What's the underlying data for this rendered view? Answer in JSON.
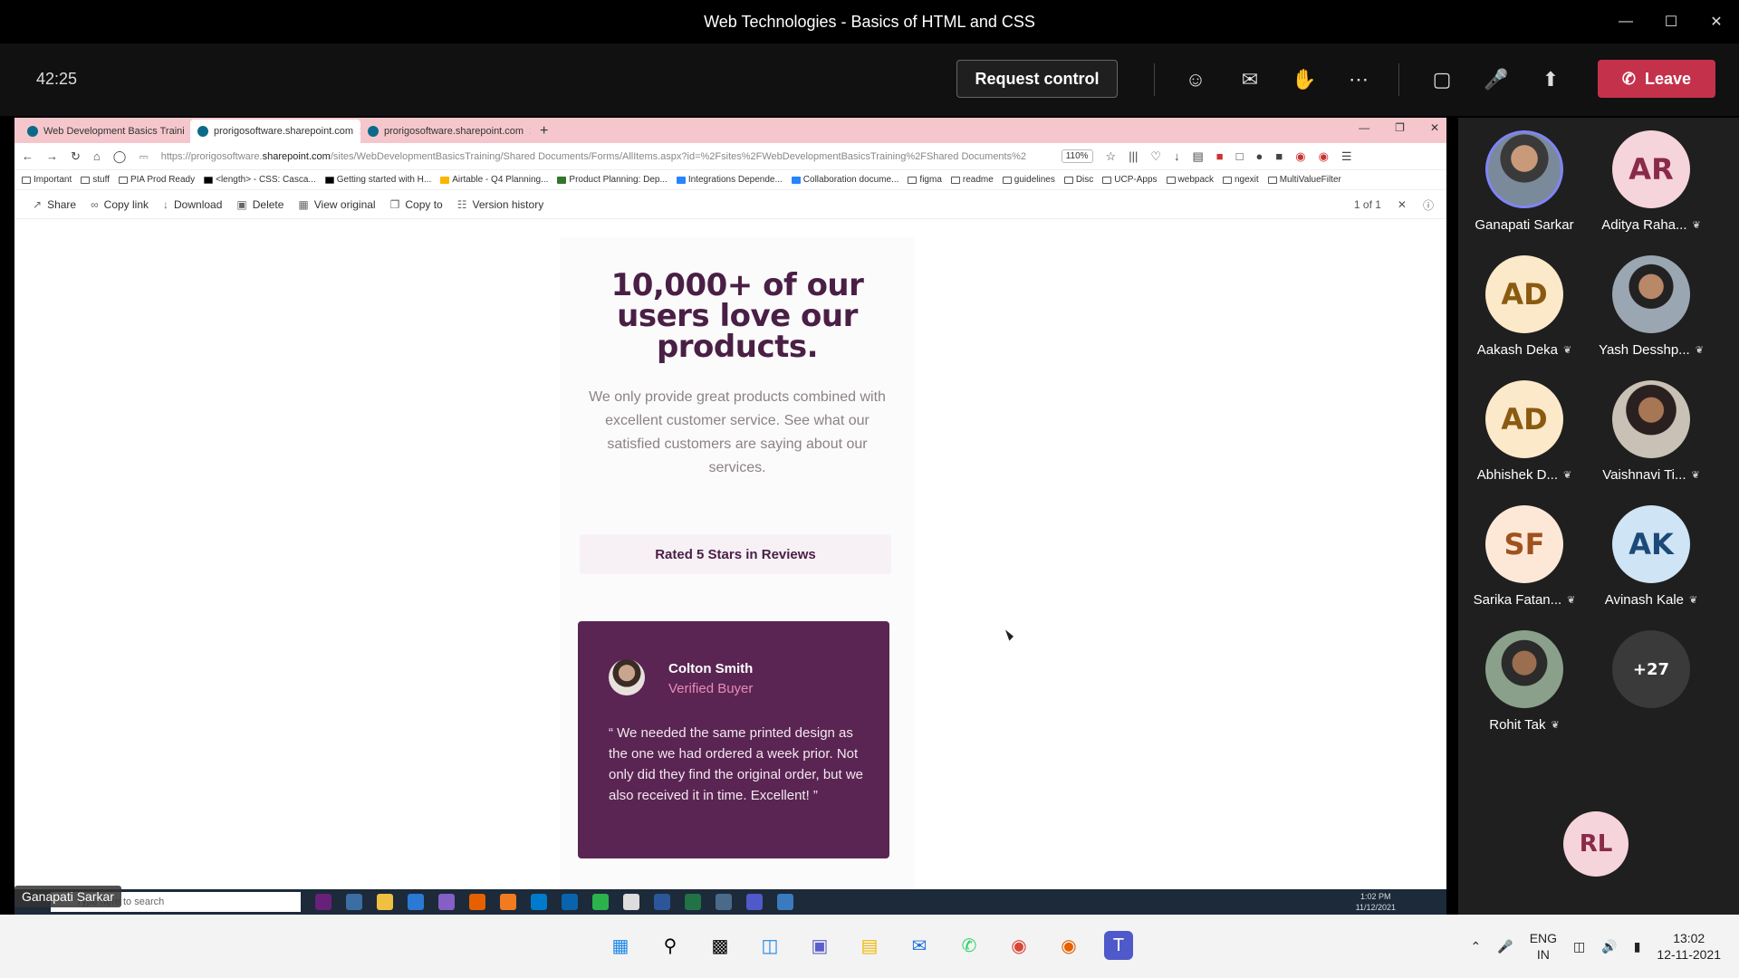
{
  "teams": {
    "window_title": "Web Technologies - Basics of HTML and CSS",
    "timer": "42:25",
    "request_control": "Request control",
    "leave": "Leave",
    "presenter": "Ganapati Sarkar"
  },
  "browser": {
    "tabs": [
      {
        "label": "Web Development Basics Traini"
      },
      {
        "label": "prorigosoftware.sharepoint.com"
      },
      {
        "label": "prorigosoftware.sharepoint.com"
      }
    ],
    "url_prefix": "https://prorigosoftware.",
    "url_domain": "sharepoint.com",
    "url_rest": "/sites/WebDevelopmentBasicsTraining/Shared Documents/Forms/AllItems.aspx?id=%2Fsites%2FWebDevelopmentBasicsTraining%2FShared Documents%2",
    "zoom": "110%",
    "bookmarks": [
      "Important",
      "stuff",
      "PIA Prod Ready",
      "<length> - CSS: Casca...",
      "Getting started with H...",
      "Airtable - Q4 Planning...",
      "Product Planning: Dep...",
      "Integrations Depende...",
      "Collaboration docume...",
      "figma",
      "readme",
      "guidelines",
      "Disc",
      "UCP-Apps",
      "webpack",
      "ngexit",
      "MultiValueFilter"
    ]
  },
  "sharepoint": {
    "share": "Share",
    "copy_link": "Copy link",
    "download": "Download",
    "delete": "Delete",
    "view_original": "View original",
    "copy_to": "Copy to",
    "version_history": "Version history",
    "page_count": "1 of 1"
  },
  "document": {
    "headline_1": "10,000+ of our",
    "headline_2": "users love our",
    "headline_3": "products.",
    "subtext": "We only provide great products combined with excellent customer service. See what our satisfied customers are saying about our services.",
    "rated": "Rated 5 Stars in Reviews",
    "review_name": "Colton Smith",
    "review_role": "Verified Buyer",
    "review_text": "“ We needed the same printed design as the one we had ordered a week prior. Not only did they find the original order, but we also received it in time. Excellent! ”"
  },
  "inner_taskbar": {
    "search_placeholder": "Type here to search",
    "time": "1:02 PM",
    "date": "11/12/2021"
  },
  "participants": [
    {
      "name": "Ganapati Sarkar",
      "initials": "",
      "muted": false
    },
    {
      "name": "Aditya Raha...",
      "initials": "AR",
      "muted": true
    },
    {
      "name": "Aakash Deka",
      "initials": "AD",
      "muted": true
    },
    {
      "name": "Yash Desshp...",
      "initials": "",
      "muted": true
    },
    {
      "name": "Abhishek D...",
      "initials": "AD",
      "muted": true
    },
    {
      "name": "Vaishnavi Ti...",
      "initials": "",
      "muted": true
    },
    {
      "name": "Sarika Fatan...",
      "initials": "SF",
      "muted": true
    },
    {
      "name": "Avinash Kale",
      "initials": "AK",
      "muted": true
    },
    {
      "name": "Rohit Tak",
      "initials": "",
      "muted": true
    },
    {
      "name": "",
      "initials": "+27",
      "muted": false
    },
    {
      "name": "",
      "initials": "RL",
      "muted": false
    }
  ],
  "taskbar": {
    "lang_1": "ENG",
    "lang_2": "IN",
    "time": "13:02",
    "date": "12-11-2021"
  },
  "colors": {
    "leave": "#c4314b",
    "headline": "#4a1f45",
    "card": "#5a2553",
    "tab_strip": "#f5c7cd"
  }
}
